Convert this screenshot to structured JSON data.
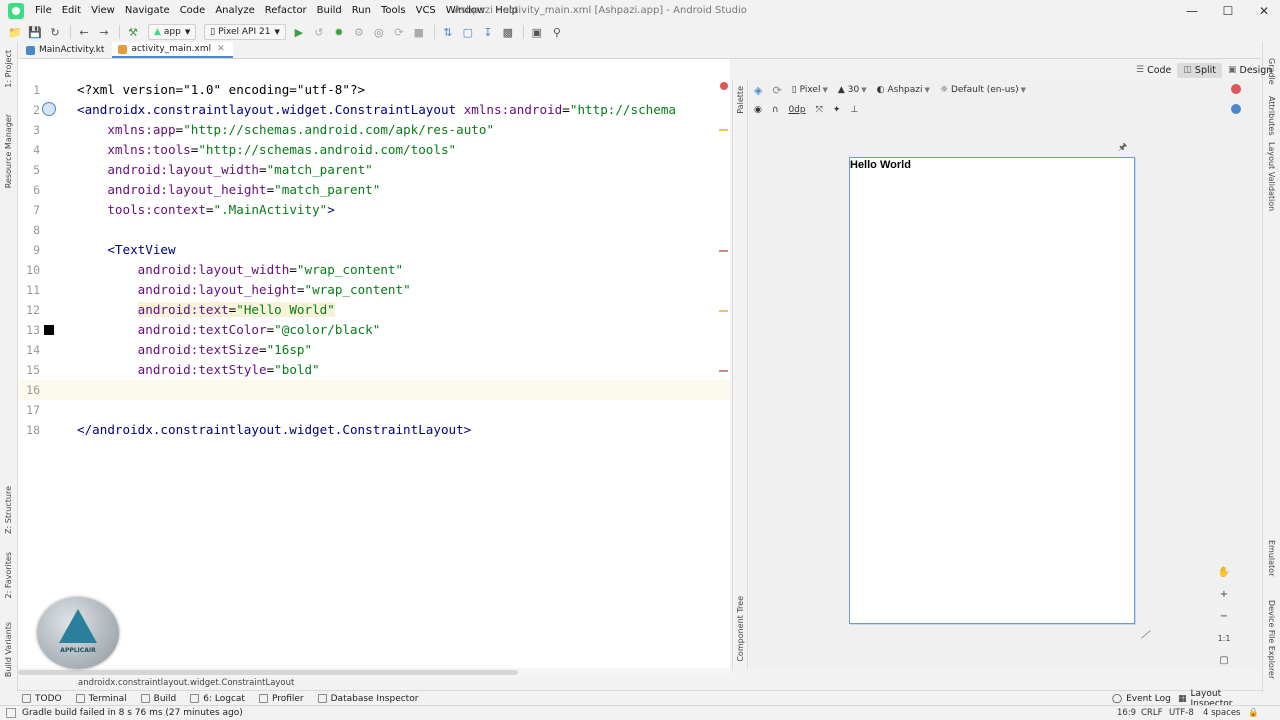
{
  "window_title": "Ashpazi - activity_main.xml [Ashpazi.app] - Android Studio",
  "menu": [
    "File",
    "Edit",
    "View",
    "Navigate",
    "Code",
    "Analyze",
    "Refactor",
    "Build",
    "Run",
    "Tools",
    "VCS",
    "Window",
    "Help"
  ],
  "toolbar": {
    "module": "app",
    "device": "Pixel API 21"
  },
  "tabs": [
    {
      "label": "MainActivity.kt",
      "active": false
    },
    {
      "label": "activity_main.xml",
      "active": true
    }
  ],
  "left_tool_windows": [
    "1: Project",
    "Resource Manager",
    "Z: Structure",
    "2: Favorites",
    "Build Variants"
  ],
  "right_tool_windows": [
    "Gradle",
    "Attributes",
    "Layout Validation",
    "Emulator",
    "Device File Explorer"
  ],
  "design_side_tabs": [
    "Palette",
    "Component Tree"
  ],
  "code_lines": [
    {
      "n": "1",
      "parts": [
        [
          "pi",
          "<?xml version=\"1.0\" encoding=\"utf-8\"?>"
        ]
      ]
    },
    {
      "n": "2",
      "parts": [
        [
          "tag",
          "<androidx.constraintlayout.widget.ConstraintLayout "
        ],
        [
          "attr",
          "xmlns:android"
        ],
        [
          "pi",
          "="
        ],
        [
          "str",
          "\"http://schema"
        ]
      ]
    },
    {
      "n": "3",
      "parts": [
        [
          "pi",
          "    "
        ],
        [
          "attr",
          "xmlns:app"
        ],
        [
          "pi",
          "="
        ],
        [
          "str",
          "\"http://schemas.android.com/apk/res-auto\""
        ]
      ]
    },
    {
      "n": "4",
      "parts": [
        [
          "pi",
          "    "
        ],
        [
          "attr",
          "xmlns:tools"
        ],
        [
          "pi",
          "="
        ],
        [
          "str",
          "\"http://schemas.android.com/tools\""
        ]
      ]
    },
    {
      "n": "5",
      "parts": [
        [
          "pi",
          "    "
        ],
        [
          "attr",
          "android:layout_width"
        ],
        [
          "pi",
          "="
        ],
        [
          "str",
          "\"match_parent\""
        ]
      ]
    },
    {
      "n": "6",
      "parts": [
        [
          "pi",
          "    "
        ],
        [
          "attr",
          "android:layout_height"
        ],
        [
          "pi",
          "="
        ],
        [
          "str",
          "\"match_parent\""
        ]
      ]
    },
    {
      "n": "7",
      "parts": [
        [
          "pi",
          "    "
        ],
        [
          "attr",
          "tools:context"
        ],
        [
          "pi",
          "="
        ],
        [
          "str",
          "\".MainActivity\""
        ],
        [
          "tag",
          ">"
        ]
      ]
    },
    {
      "n": "8",
      "parts": []
    },
    {
      "n": "9",
      "parts": [
        [
          "pi",
          "    "
        ],
        [
          "tag",
          "<TextView"
        ]
      ]
    },
    {
      "n": "10",
      "parts": [
        [
          "pi",
          "        "
        ],
        [
          "attr",
          "android:layout_width"
        ],
        [
          "pi",
          "="
        ],
        [
          "str",
          "\"wrap_content\""
        ]
      ]
    },
    {
      "n": "11",
      "parts": [
        [
          "pi",
          "        "
        ],
        [
          "attr",
          "android:layout_height"
        ],
        [
          "pi",
          "="
        ],
        [
          "str",
          "\"wrap_content\""
        ]
      ]
    },
    {
      "n": "12",
      "parts": [
        [
          "pi",
          "        "
        ],
        [
          "attr",
          "android:text"
        ],
        [
          "pi",
          "="
        ],
        [
          "str",
          "\"Hello World\""
        ]
      ]
    },
    {
      "n": "13",
      "parts": [
        [
          "pi",
          "        "
        ],
        [
          "attr",
          "android:textColor"
        ],
        [
          "pi",
          "="
        ],
        [
          "str",
          "\"@color/black\""
        ]
      ]
    },
    {
      "n": "14",
      "parts": [
        [
          "pi",
          "        "
        ],
        [
          "attr",
          "android:textSize"
        ],
        [
          "pi",
          "="
        ],
        [
          "str",
          "\"16sp\""
        ]
      ]
    },
    {
      "n": "15",
      "parts": [
        [
          "pi",
          "        "
        ],
        [
          "attr",
          "android:textStyle"
        ],
        [
          "pi",
          "="
        ],
        [
          "str",
          "\"bold\""
        ]
      ]
    },
    {
      "n": "16",
      "parts": []
    },
    {
      "n": "17",
      "parts": []
    },
    {
      "n": "18",
      "parts": [
        [
          "tag",
          "</androidx.constraintlayout.widget.ConstraintLayout>"
        ]
      ]
    }
  ],
  "view_modes": [
    {
      "label": "Code",
      "active": false
    },
    {
      "label": "Split",
      "active": true
    },
    {
      "label": "Design",
      "active": false
    }
  ],
  "design_toolbar": {
    "device": "Pixel",
    "api": "30",
    "theme": "Ashpazi",
    "locale": "Default (en-us)",
    "margin": "0dp"
  },
  "preview_text": "Hello World",
  "zoom_ratio": "1:1",
  "breadcrumb": "androidx.constraintlayout.widget.ConstraintLayout",
  "bottom_tabs": [
    "TODO",
    "Terminal",
    "Build",
    "6: Logcat",
    "Profiler",
    "Database Inspector"
  ],
  "bottom_tabs_right": [
    "Event Log",
    "Layout Inspector"
  ],
  "status": {
    "message": "Gradle build failed in 8 s 76 ms (27 minutes ago)",
    "position": "16:9",
    "line_sep": "CRLF",
    "encoding": "UTF-8",
    "indent": "4 spaces"
  },
  "watermark_text": "APPLICAIR",
  "colors": {
    "xml_tag": "#000080",
    "xml_attr": "#660e7a",
    "xml_string": "#067d17",
    "selection_frame": "#6b9ad6"
  }
}
